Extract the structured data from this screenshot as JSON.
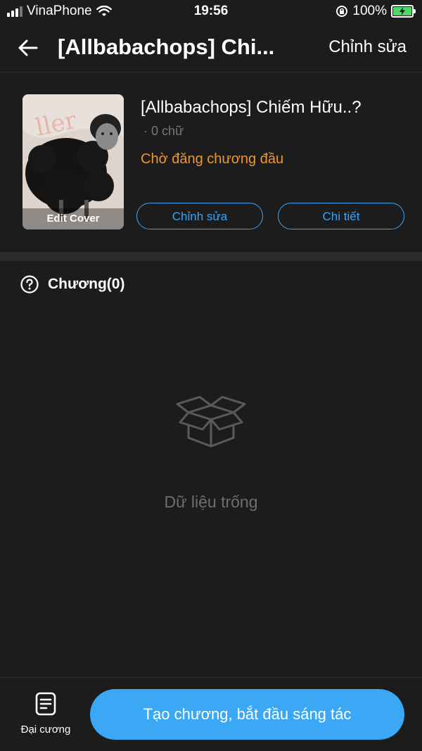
{
  "status_bar": {
    "carrier": "VinaPhone",
    "time": "19:56",
    "battery": "100%"
  },
  "header": {
    "title": "[Allbabachops] Chi...",
    "edit_label": "Chỉnh sửa"
  },
  "story": {
    "cover_label": "Edit Cover",
    "title": "[Allbabachops] Chiếm Hữu..?",
    "word_count": "· 0 chữ",
    "status": "Chờ đăng chương đầu",
    "edit_button": "Chỉnh sửa",
    "detail_button": "Chi tiết"
  },
  "chapters": {
    "label": "Chương(0)",
    "empty_text": "Dữ liệu trống"
  },
  "bottom_bar": {
    "outline_label": "Đại cương",
    "create_button": "Tạo chương, bắt đầu sáng tác"
  },
  "colors": {
    "accent_blue": "#3ba8f5",
    "status_orange": "#f0962c",
    "background": "#1c1c1c"
  },
  "icons": [
    "back-arrow-icon",
    "help-circle-icon",
    "empty-box-icon",
    "document-icon",
    "wifi-icon",
    "battery-icon",
    "signal-icon",
    "orientation-lock-icon"
  ]
}
